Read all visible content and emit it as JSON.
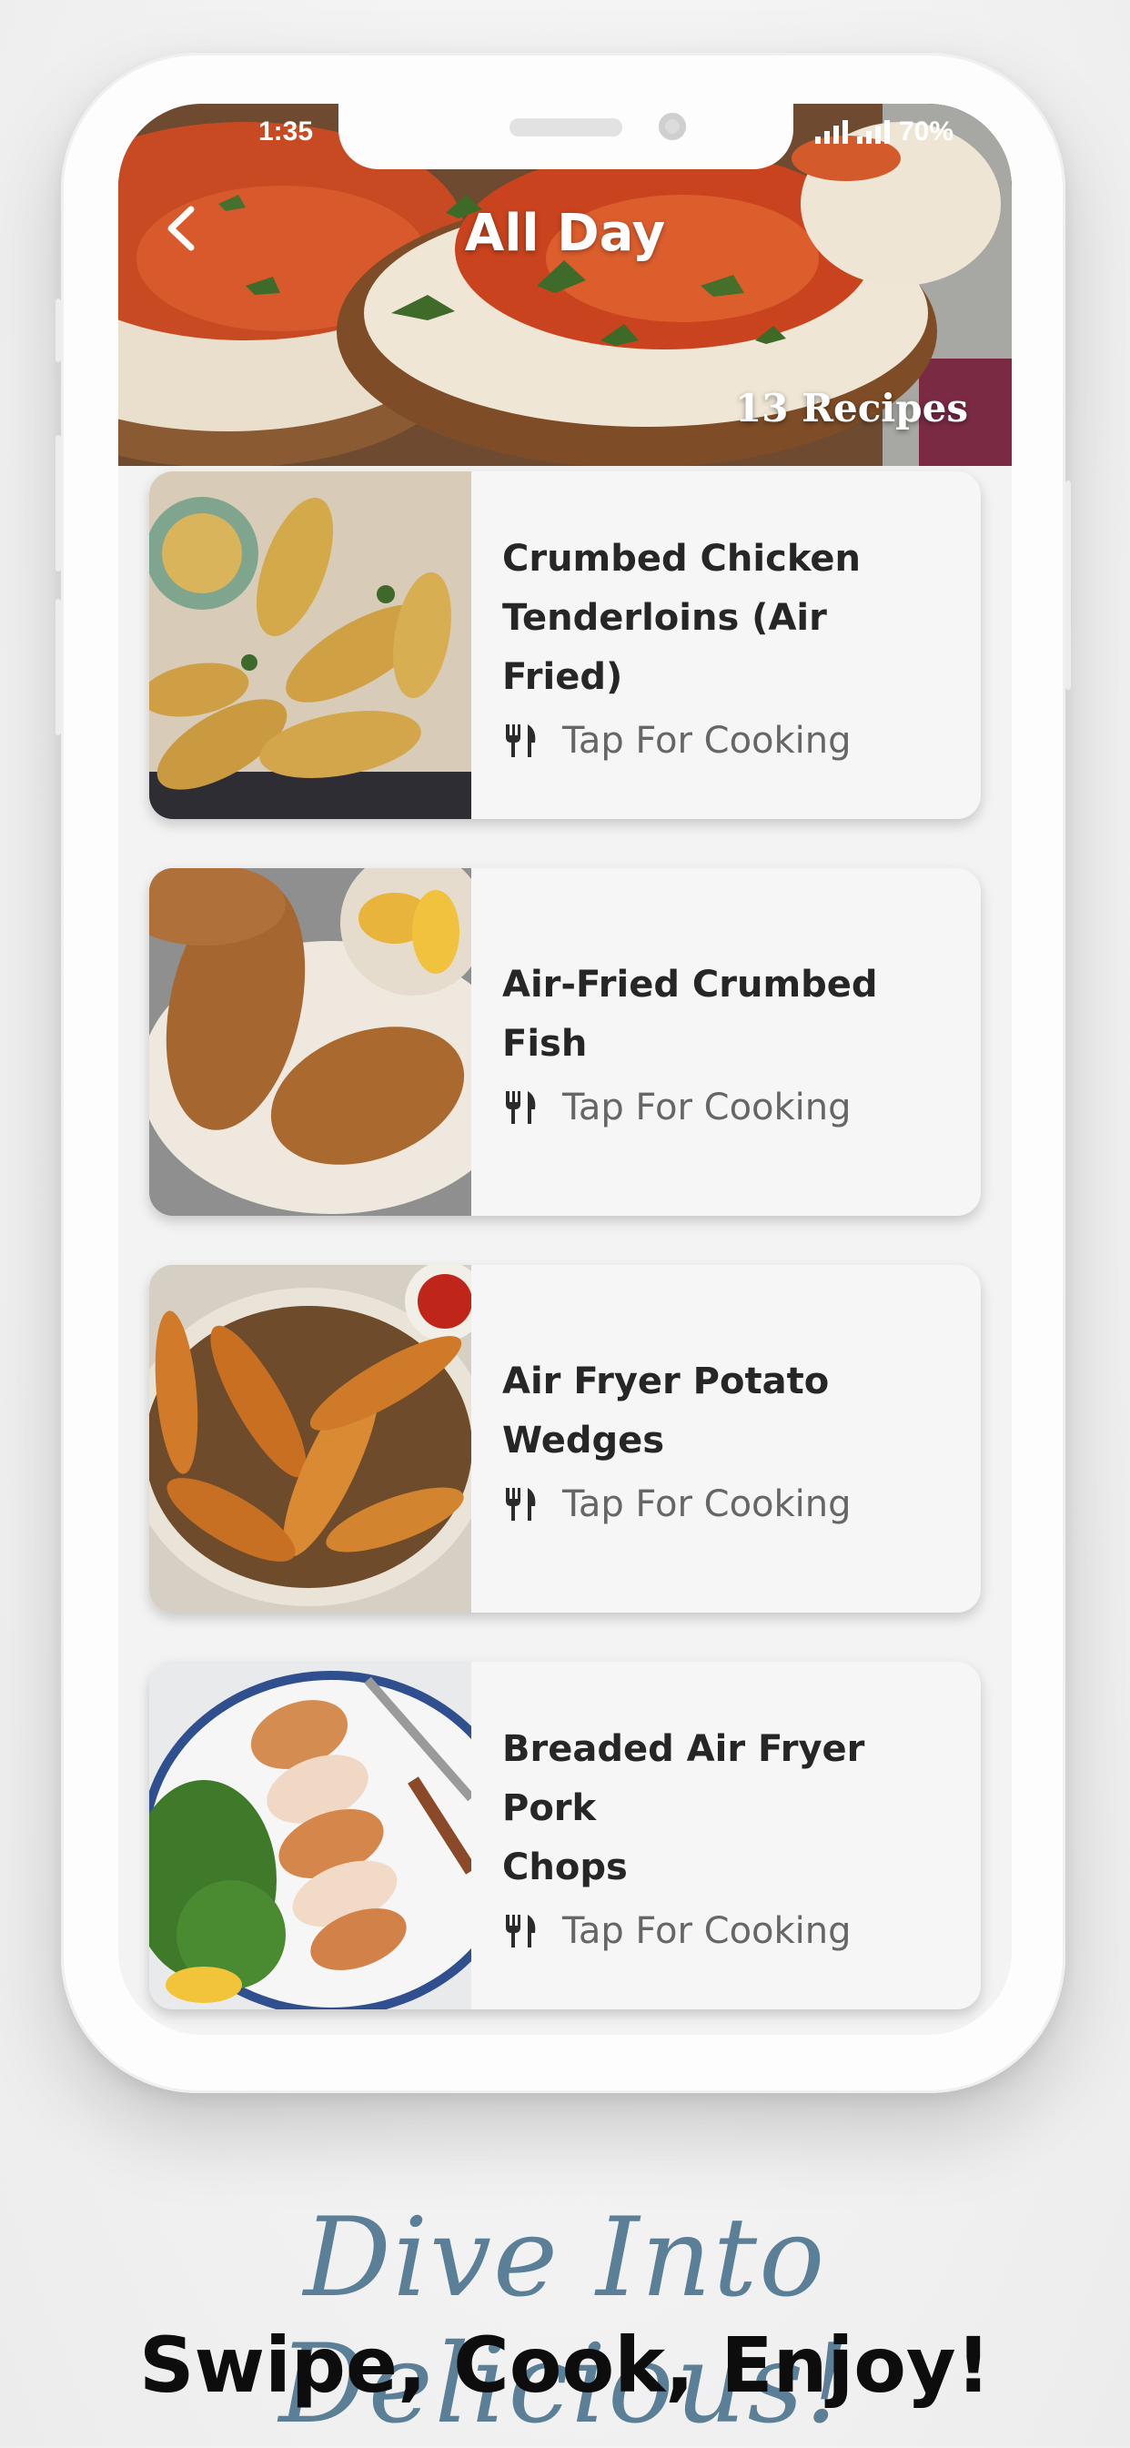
{
  "status_bar": {
    "time": "1:35",
    "battery": "70%"
  },
  "header": {
    "title": "All Day",
    "recipe_count": "13 Recipes"
  },
  "recipes": [
    {
      "title_line1": "Crumbed Chicken",
      "title_line2": "Tenderloins (Air Fried)",
      "action_label": "Tap For Cooking"
    },
    {
      "title_line1": "Air-Fried Crumbed Fish",
      "title_line2": "",
      "action_label": "Tap For Cooking"
    },
    {
      "title_line1": "Air Fryer Potato Wedges",
      "title_line2": "",
      "action_label": "Tap For Cooking"
    },
    {
      "title_line1": "Breaded Air Fryer Pork",
      "title_line2": "Chops",
      "action_label": "Tap For Cooking"
    }
  ],
  "tagline": {
    "headline": "Dive Into Delicious!",
    "subline": "Swipe, Cook, Enjoy!"
  },
  "icons": {
    "back": "chevron-left-icon",
    "action": "fork-knife-icon",
    "signal": "signal-icon"
  },
  "colors": {
    "headline": "#5b7f96",
    "subline": "#0d0d0d",
    "card_bg": "#f6f6f6"
  }
}
